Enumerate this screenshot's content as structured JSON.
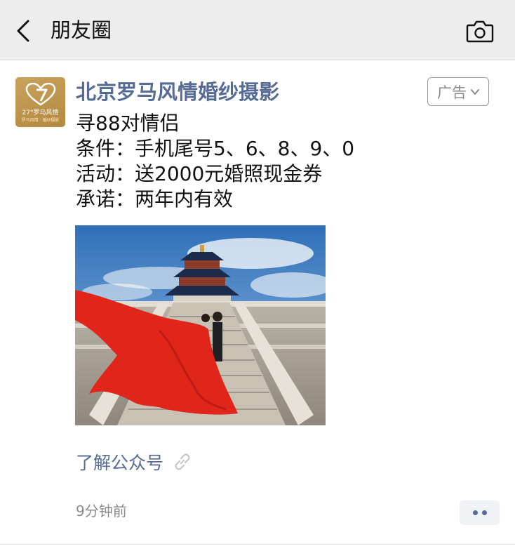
{
  "header": {
    "title": "朋友圈",
    "back_icon": "chevron-left-icon",
    "camera_icon": "camera-icon"
  },
  "post": {
    "avatar": {
      "logo_text": "27°罗马风情",
      "logo_sub": "罗马风情 · 婚纱摄影"
    },
    "author": "北京罗马风情婚纱摄影",
    "ad_label": "广告",
    "lines": [
      "寻88对情侣",
      "条件：手机尾号5、6、8、9、0",
      "活动：送2000元婚照现金券",
      "承诺：两年内有效"
    ],
    "link_text": "了解公众号",
    "timestamp": "9分钟前"
  },
  "colors": {
    "link": "#566b95",
    "header_bg": "#ededed",
    "avatar_gold": "#c9a25c"
  }
}
